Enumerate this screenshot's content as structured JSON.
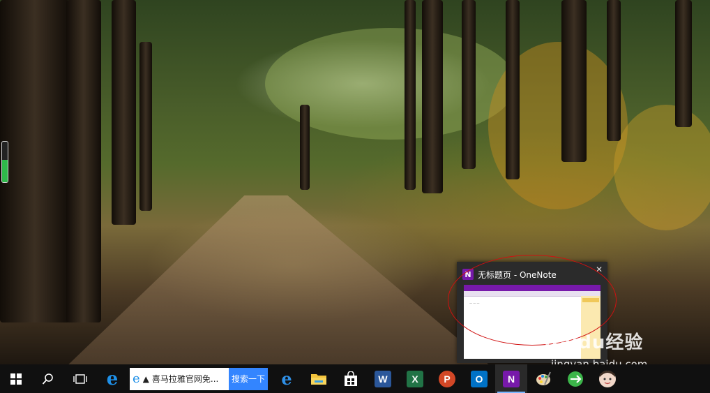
{
  "desktop": {
    "level_fraction": 0.55
  },
  "preview": {
    "title": "无标题页 - OneNote",
    "close_label": "✕",
    "app_icon_letter": "N"
  },
  "taskbar": {
    "search_query": "喜马拉雅官网免...",
    "search_button": "搜索一下",
    "apps": [
      {
        "name": "ie",
        "letter": "e",
        "color": "#1e90e8"
      },
      {
        "name": "edge",
        "letter": "e",
        "color": "#0f6cd1"
      },
      {
        "name": "file-explorer",
        "letter": "",
        "color": "#f3c33b"
      },
      {
        "name": "store",
        "letter": "",
        "color": "#ffffff"
      },
      {
        "name": "word",
        "letter": "W",
        "color": "#2b579a"
      },
      {
        "name": "excel",
        "letter": "X",
        "color": "#217346"
      },
      {
        "name": "powerpoint",
        "letter": "P",
        "color": "#d24726"
      },
      {
        "name": "outlook",
        "letter": "O",
        "color": "#0072c6"
      },
      {
        "name": "onenote",
        "letter": "N",
        "color": "#7719aa"
      }
    ]
  },
  "watermark": {
    "brand": "Baidu经验",
    "url": "jingyan.baidu.com"
  },
  "colors": {
    "taskbar": "#101010",
    "onenote": "#7719aa",
    "annotation": "#d01010",
    "search_button": "#3385ff"
  }
}
